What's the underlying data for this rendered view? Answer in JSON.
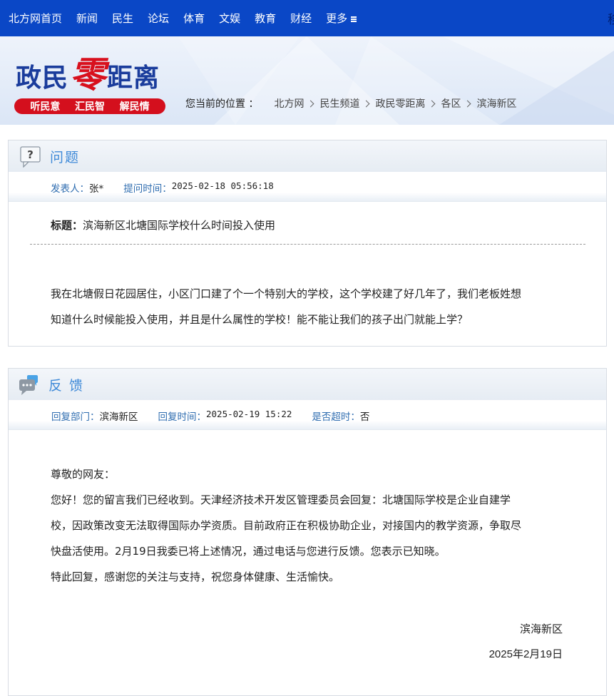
{
  "nav": {
    "items": [
      "北方网首页",
      "新闻",
      "民生",
      "论坛",
      "体育",
      "文娱",
      "教育",
      "财经"
    ],
    "more": "更多",
    "edge_char": "移"
  },
  "banner": {
    "logo_part1": "政民",
    "logo_part2": "零",
    "logo_part3": "距离",
    "slogans": [
      "听民意",
      "汇民智",
      "解民情"
    ]
  },
  "breadcrumb": {
    "label": "您当前的位置 ：",
    "items": [
      "北方网",
      "民生频道",
      "政民零距离",
      "各区",
      "滨海新区"
    ]
  },
  "question": {
    "heading": "问题",
    "poster_label": "发表人：",
    "poster": "张*",
    "time_label": "提问时间：",
    "time": "2025-02-18 05:56:18",
    "title_label": "标题：",
    "title": "滨海新区北塘国际学校什么时间投入使用",
    "body_line1": "我在北塘假日花园居住，小区门口建了个一个特别大的学校，这个学校建了好几年了，我们老板姓想",
    "body_line2": "知道什么时候能投入使用，并且是什么属性的学校！能不能让我们的孩子出门就能上学？"
  },
  "reply": {
    "heading": "反 馈",
    "dept_label": "回复部门：",
    "dept": "滨海新区",
    "time_label": "回复时间：",
    "time": "2025-02-19 15:22",
    "overdue_label": "是否超时：",
    "overdue": "否",
    "greeting": "尊敬的网友：",
    "line1": "您好！您的留言我们已经收到。天津经济技术开发区管理委员会回复：北塘国际学校是企业自建学",
    "line2": "校，因政策改变无法取得国际办学资质。目前政府正在积极协助企业，对接国内的教学资源，争取尽",
    "line3": "快盘活使用。2月19日我委已将上述情况，通过电话与您进行反馈。您表示已知晓。",
    "line4": "特此回复，感谢您的关注与支持，祝您身体健康、生活愉快。",
    "sign_dept": "滨海新区",
    "sign_date": "2025年2月19日"
  },
  "colors": {
    "nav_bg": "#0a47c6",
    "logo_blue": "#1a3c9c",
    "logo_red": "#d8101d",
    "heading_blue": "#3f8ad8",
    "meta_label": "#2f6db0"
  }
}
